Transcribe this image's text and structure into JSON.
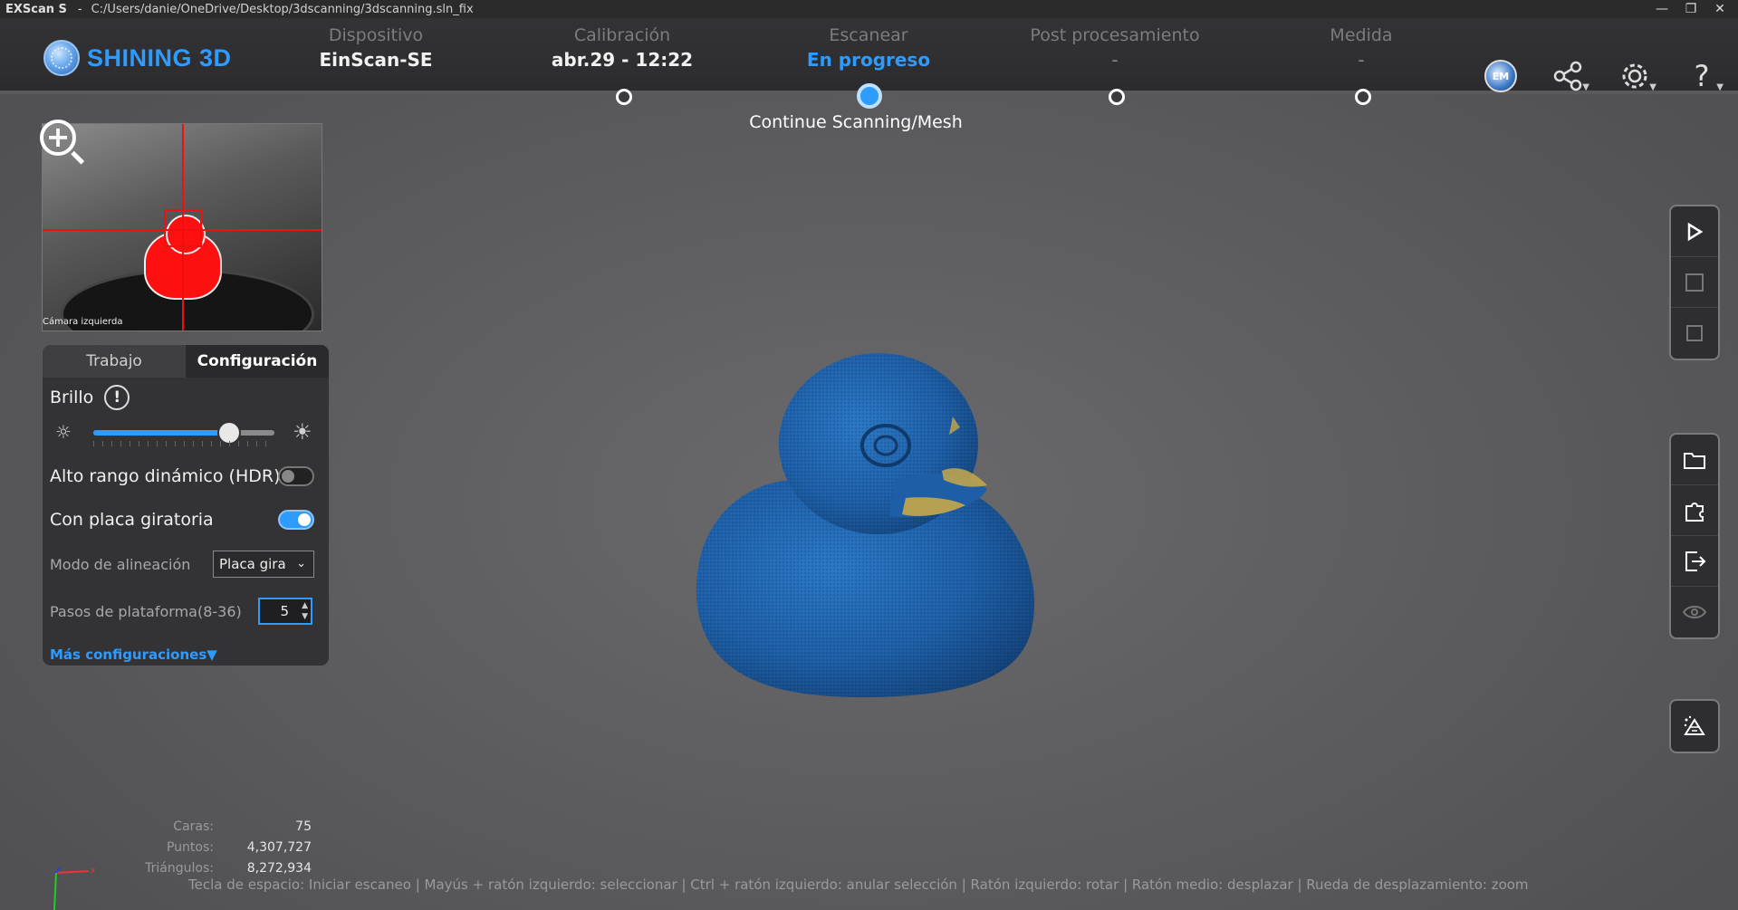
{
  "window": {
    "app": "EXScan S",
    "separator": "-",
    "path": "C:/Users/danie/OneDrive/Desktop/3dscanning/3dscanning.sln_fix",
    "minimize": "—",
    "restore": "❐",
    "close": "✕"
  },
  "brand": {
    "name": "SHINING 3D"
  },
  "steps": [
    {
      "label": "Dispositivo",
      "value": "EinScan-SE"
    },
    {
      "label": "Calibración",
      "value": "abr.29 - 12:22"
    },
    {
      "label": "Escanear",
      "value": "En progreso"
    },
    {
      "label": "Post procesamiento",
      "value": "-"
    },
    {
      "label": "Medida",
      "value": "-"
    }
  ],
  "progress_caption": "Continue Scanning/Mesh",
  "camera": {
    "caption": "Cámara izquierda"
  },
  "panel": {
    "tabs": [
      "Trabajo",
      "Configuración"
    ],
    "active_tab": 1,
    "brightness_label": "Brillo",
    "brightness_level": 0.75,
    "hdr_label": "Alto rango dinámico (HDR)",
    "hdr_on": false,
    "turntable_label": "Con placa giratoria",
    "turntable_on": true,
    "align_label": "Modo de alineación",
    "align_value": "Placa gira",
    "steps_label": "Pasos de plataforma(8-36)",
    "steps_value": "5",
    "more_label": "Más configuraciones▼"
  },
  "stats": [
    {
      "label": "Caras:",
      "value": "75"
    },
    {
      "label": "Puntos:",
      "value": "4,307,727"
    },
    {
      "label": "Triángulos:",
      "value": "8,272,934"
    }
  ],
  "hint": "Tecla de espacio: Iniciar escaneo | Mayús + ratón izquierdo: seleccionar | Ctrl + ratón izquierdo: anular selección | Ratón izquierdo: rotar | Ratón medio: desplazar | Rueda de desplazamiento: zoom",
  "colors": {
    "accent": "#2e9bff",
    "model": "#1f5fa8",
    "highlight": "#c8a84a"
  },
  "icons": [
    "em-icon",
    "share-icon",
    "settings-icon",
    "help-icon",
    "play-icon",
    "select-icon",
    "stop-icon",
    "folder-icon",
    "puzzle-icon",
    "export-icon",
    "eye-icon",
    "mesh-icon"
  ]
}
